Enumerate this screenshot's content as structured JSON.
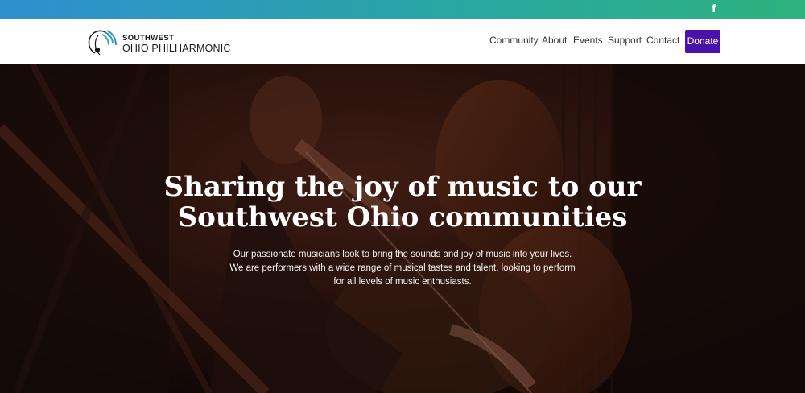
{
  "topbar": {
    "social_icon": "facebook-icon",
    "social_glyph": "f",
    "colors": [
      "#2e8fd0",
      "#2aa6a4",
      "#2fb27e"
    ]
  },
  "header": {
    "logo": {
      "line1": "SOUTHWEST",
      "line2": "OHIO PHILHARMONIC",
      "mark_icon": "treble-clef-icon"
    },
    "nav": [
      {
        "label": "Community"
      },
      {
        "label": "About"
      },
      {
        "label": "Events"
      },
      {
        "label": "Support"
      },
      {
        "label": "Contact"
      }
    ],
    "donate_label": "Donate",
    "donate_color": "#4a12a8"
  },
  "hero": {
    "title_line1": "Sharing the joy of music to our",
    "title_line2": "Southwest Ohio communities",
    "description": "Our passionate musicians look to bring the sounds and joy of music into your lives. We are performers with a wide range of musical tastes and talent, looking to perform for all levels of music enthusiasts."
  }
}
